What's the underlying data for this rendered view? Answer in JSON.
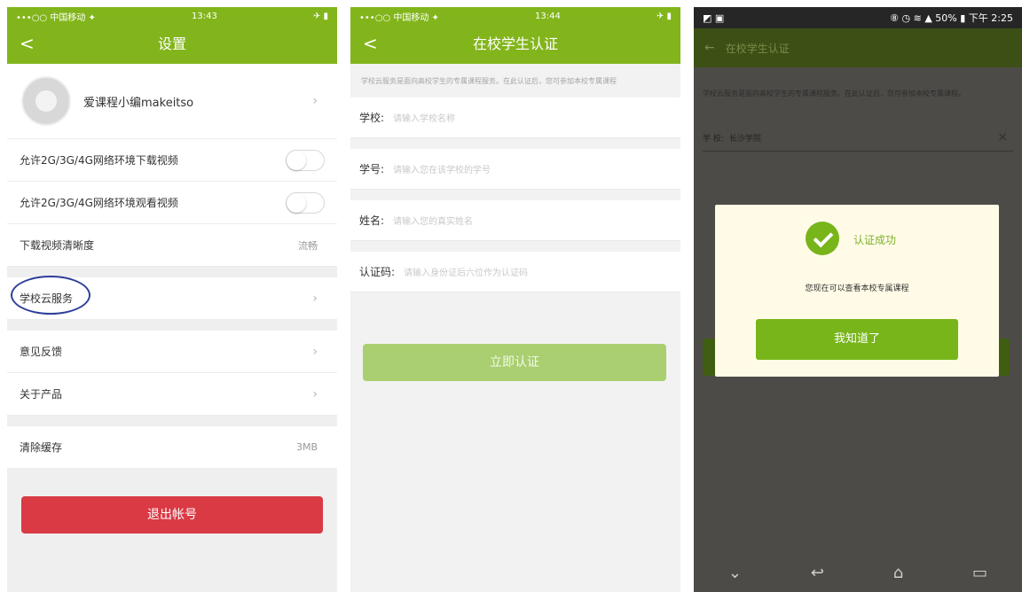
{
  "panel1": {
    "status": {
      "left": "•••○○ 中国移动 ✦",
      "time": "13:43",
      "right": "✈ ▮"
    },
    "nav": {
      "back": "<",
      "title": "设置"
    },
    "profile": {
      "name": "爱课程小编makeitso"
    },
    "items": [
      {
        "label": "允许2G/3G/4G网络环境下载视频"
      },
      {
        "label": "允许2G/3G/4G网络环境观看视频"
      },
      {
        "label": "下载视频清晰度",
        "value": "流畅"
      },
      {
        "label": "学校云服务"
      },
      {
        "label": "意见反馈"
      },
      {
        "label": "关于产品"
      },
      {
        "label": "清除缓存",
        "value": "3MB"
      }
    ],
    "logout": "退出帐号",
    "colors": {
      "accent": "#82b51b",
      "danger": "#d93a44",
      "highlight": "#2d3f9a"
    }
  },
  "panel2": {
    "status": {
      "left": "•••○○ 中国移动 ✦",
      "time": "13:44",
      "right": "✈ ▮"
    },
    "nav": {
      "back": "<",
      "title": "在校学生认证"
    },
    "description": "学校云服务是面向高校学生的专属课程服务。在此认证后，您可参加本校专属课程",
    "fields": [
      {
        "label": "学校:",
        "placeholder": "请输入学校名称"
      },
      {
        "label": "学号:",
        "placeholder": "请输入您在该学校的学号"
      },
      {
        "label": "姓名:",
        "placeholder": "请输入您的真实姓名"
      },
      {
        "label": "认证码:",
        "placeholder": "请输入身份证后六位作为认证码"
      }
    ],
    "submit": "立即认证"
  },
  "panel3": {
    "status": {
      "left": "◩ ▣",
      "right": "⑧ ◷ ≋ ▲ 50% ▮ 下午 2:25"
    },
    "nav": {
      "back": "←",
      "title": "在校学生认证"
    },
    "description": "学校云服务是面向高校学生的专属课程服务。在此认证后，您可参加本校专属课程。",
    "school": {
      "label": "学 校:",
      "value": "长沙学院",
      "clear": "×"
    },
    "dialog": {
      "title": "认证成功",
      "message": "您现在可以查看本校专属课程",
      "ok": "我知道了"
    },
    "navbar": {
      "down": "⌄",
      "back": "↩",
      "home": "⌂",
      "recent": "▭"
    }
  }
}
